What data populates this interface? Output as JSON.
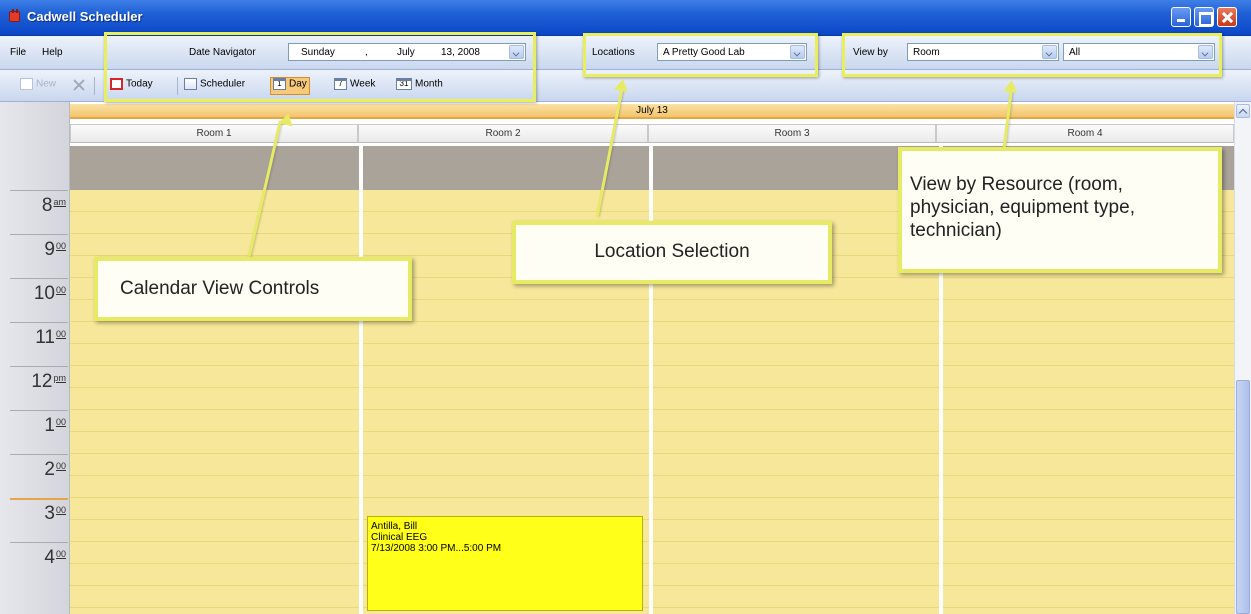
{
  "window": {
    "title": "Cadwell Scheduler"
  },
  "menu": {
    "file": "File",
    "help": "Help"
  },
  "date_navigator": {
    "label": "Date Navigator",
    "weekday": "Sunday",
    "comma": ",",
    "month": "July",
    "day_year": "13, 2008"
  },
  "locations": {
    "label": "Locations",
    "value": "A Pretty Good Lab"
  },
  "view_by": {
    "label": "View by",
    "value": "Room",
    "filter_value": "All"
  },
  "toolbar": {
    "new_label": "New",
    "today_label": "Today",
    "scheduler_label": "Scheduler",
    "day_label": "Day",
    "day_icon": "1",
    "week_label": "Week",
    "week_icon": "7",
    "month_label": "Month",
    "month_icon": "31",
    "active_view": "Day"
  },
  "calendar": {
    "date_header": "July 13",
    "rooms": [
      "Room 1",
      "Room 2",
      "Room 3",
      "Room 4"
    ],
    "hours": [
      {
        "h": "8",
        "s": "am"
      },
      {
        "h": "9",
        "s": "00"
      },
      {
        "h": "10",
        "s": "00"
      },
      {
        "h": "11",
        "s": "00"
      },
      {
        "h": "12",
        "s": "pm"
      },
      {
        "h": "1",
        "s": "00"
      },
      {
        "h": "2",
        "s": "00"
      },
      {
        "h": "3",
        "s": "00"
      },
      {
        "h": "4",
        "s": "00"
      }
    ]
  },
  "appointment": {
    "patient": "Antilla, Bill",
    "type": "Clinical EEG",
    "time": "7/13/2008 3:00 PM...5:00 PM",
    "room": "Room 2",
    "color": "#ffff1a"
  },
  "callouts": {
    "calendar_view": "Calendar View Controls",
    "location": "Location Selection",
    "resource": "View by Resource (room, physician, equipment type, technician)"
  },
  "colors": {
    "accent": "#e6ea65",
    "titlebar": "#1f5fd6",
    "slot": "#f6e79a"
  }
}
